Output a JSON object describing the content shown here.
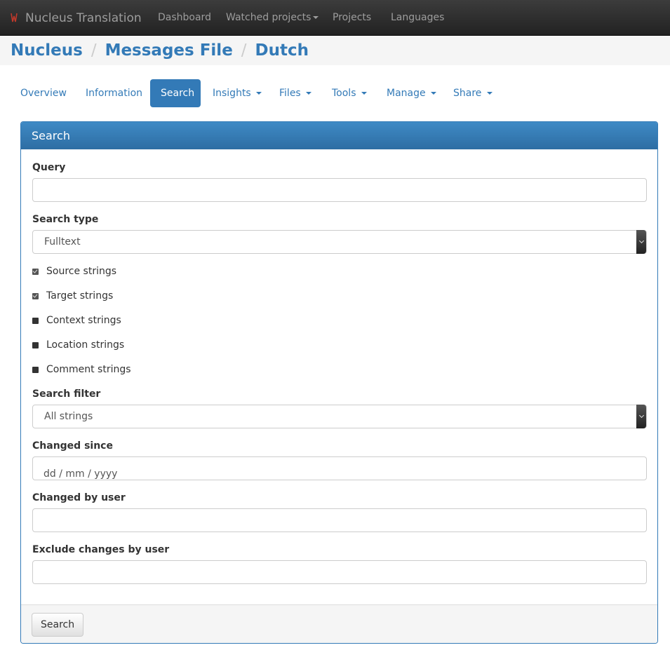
{
  "navbar": {
    "brand": "Nucleus Translation",
    "items": [
      {
        "label": "Dashboard"
      },
      {
        "label": "Watched projects"
      },
      {
        "label": "Projects"
      },
      {
        "label": "Languages"
      }
    ]
  },
  "breadcrumb": [
    "Nucleus",
    "Messages File",
    "Dutch"
  ],
  "tabs": [
    {
      "label": "Overview"
    },
    {
      "label": "Information"
    },
    {
      "label": "Search"
    },
    {
      "label": "Insights"
    },
    {
      "label": "Files"
    },
    {
      "label": "Tools"
    },
    {
      "label": "Manage"
    },
    {
      "label": "Share"
    }
  ],
  "form": {
    "title": "Search",
    "query_label": "Query",
    "query_value": "",
    "search_type_label": "Search type",
    "search_type_value": "Fulltext",
    "checkboxes": [
      {
        "label": "Source strings",
        "checked": true
      },
      {
        "label": "Target strings",
        "checked": true
      },
      {
        "label": "Context strings",
        "checked": false
      },
      {
        "label": "Location strings",
        "checked": false
      },
      {
        "label": "Comment strings",
        "checked": false
      }
    ],
    "filter_label": "Search filter",
    "filter_value": "All strings",
    "changed_since_label": "Changed since",
    "changed_since_placeholder": "dd / mm / yyyy",
    "changed_by_label": "Changed by user",
    "exclude_label": "Exclude changes by user",
    "submit_label": "Search"
  },
  "colors": {
    "accent": "#337ab7",
    "navbar": "#222222"
  }
}
